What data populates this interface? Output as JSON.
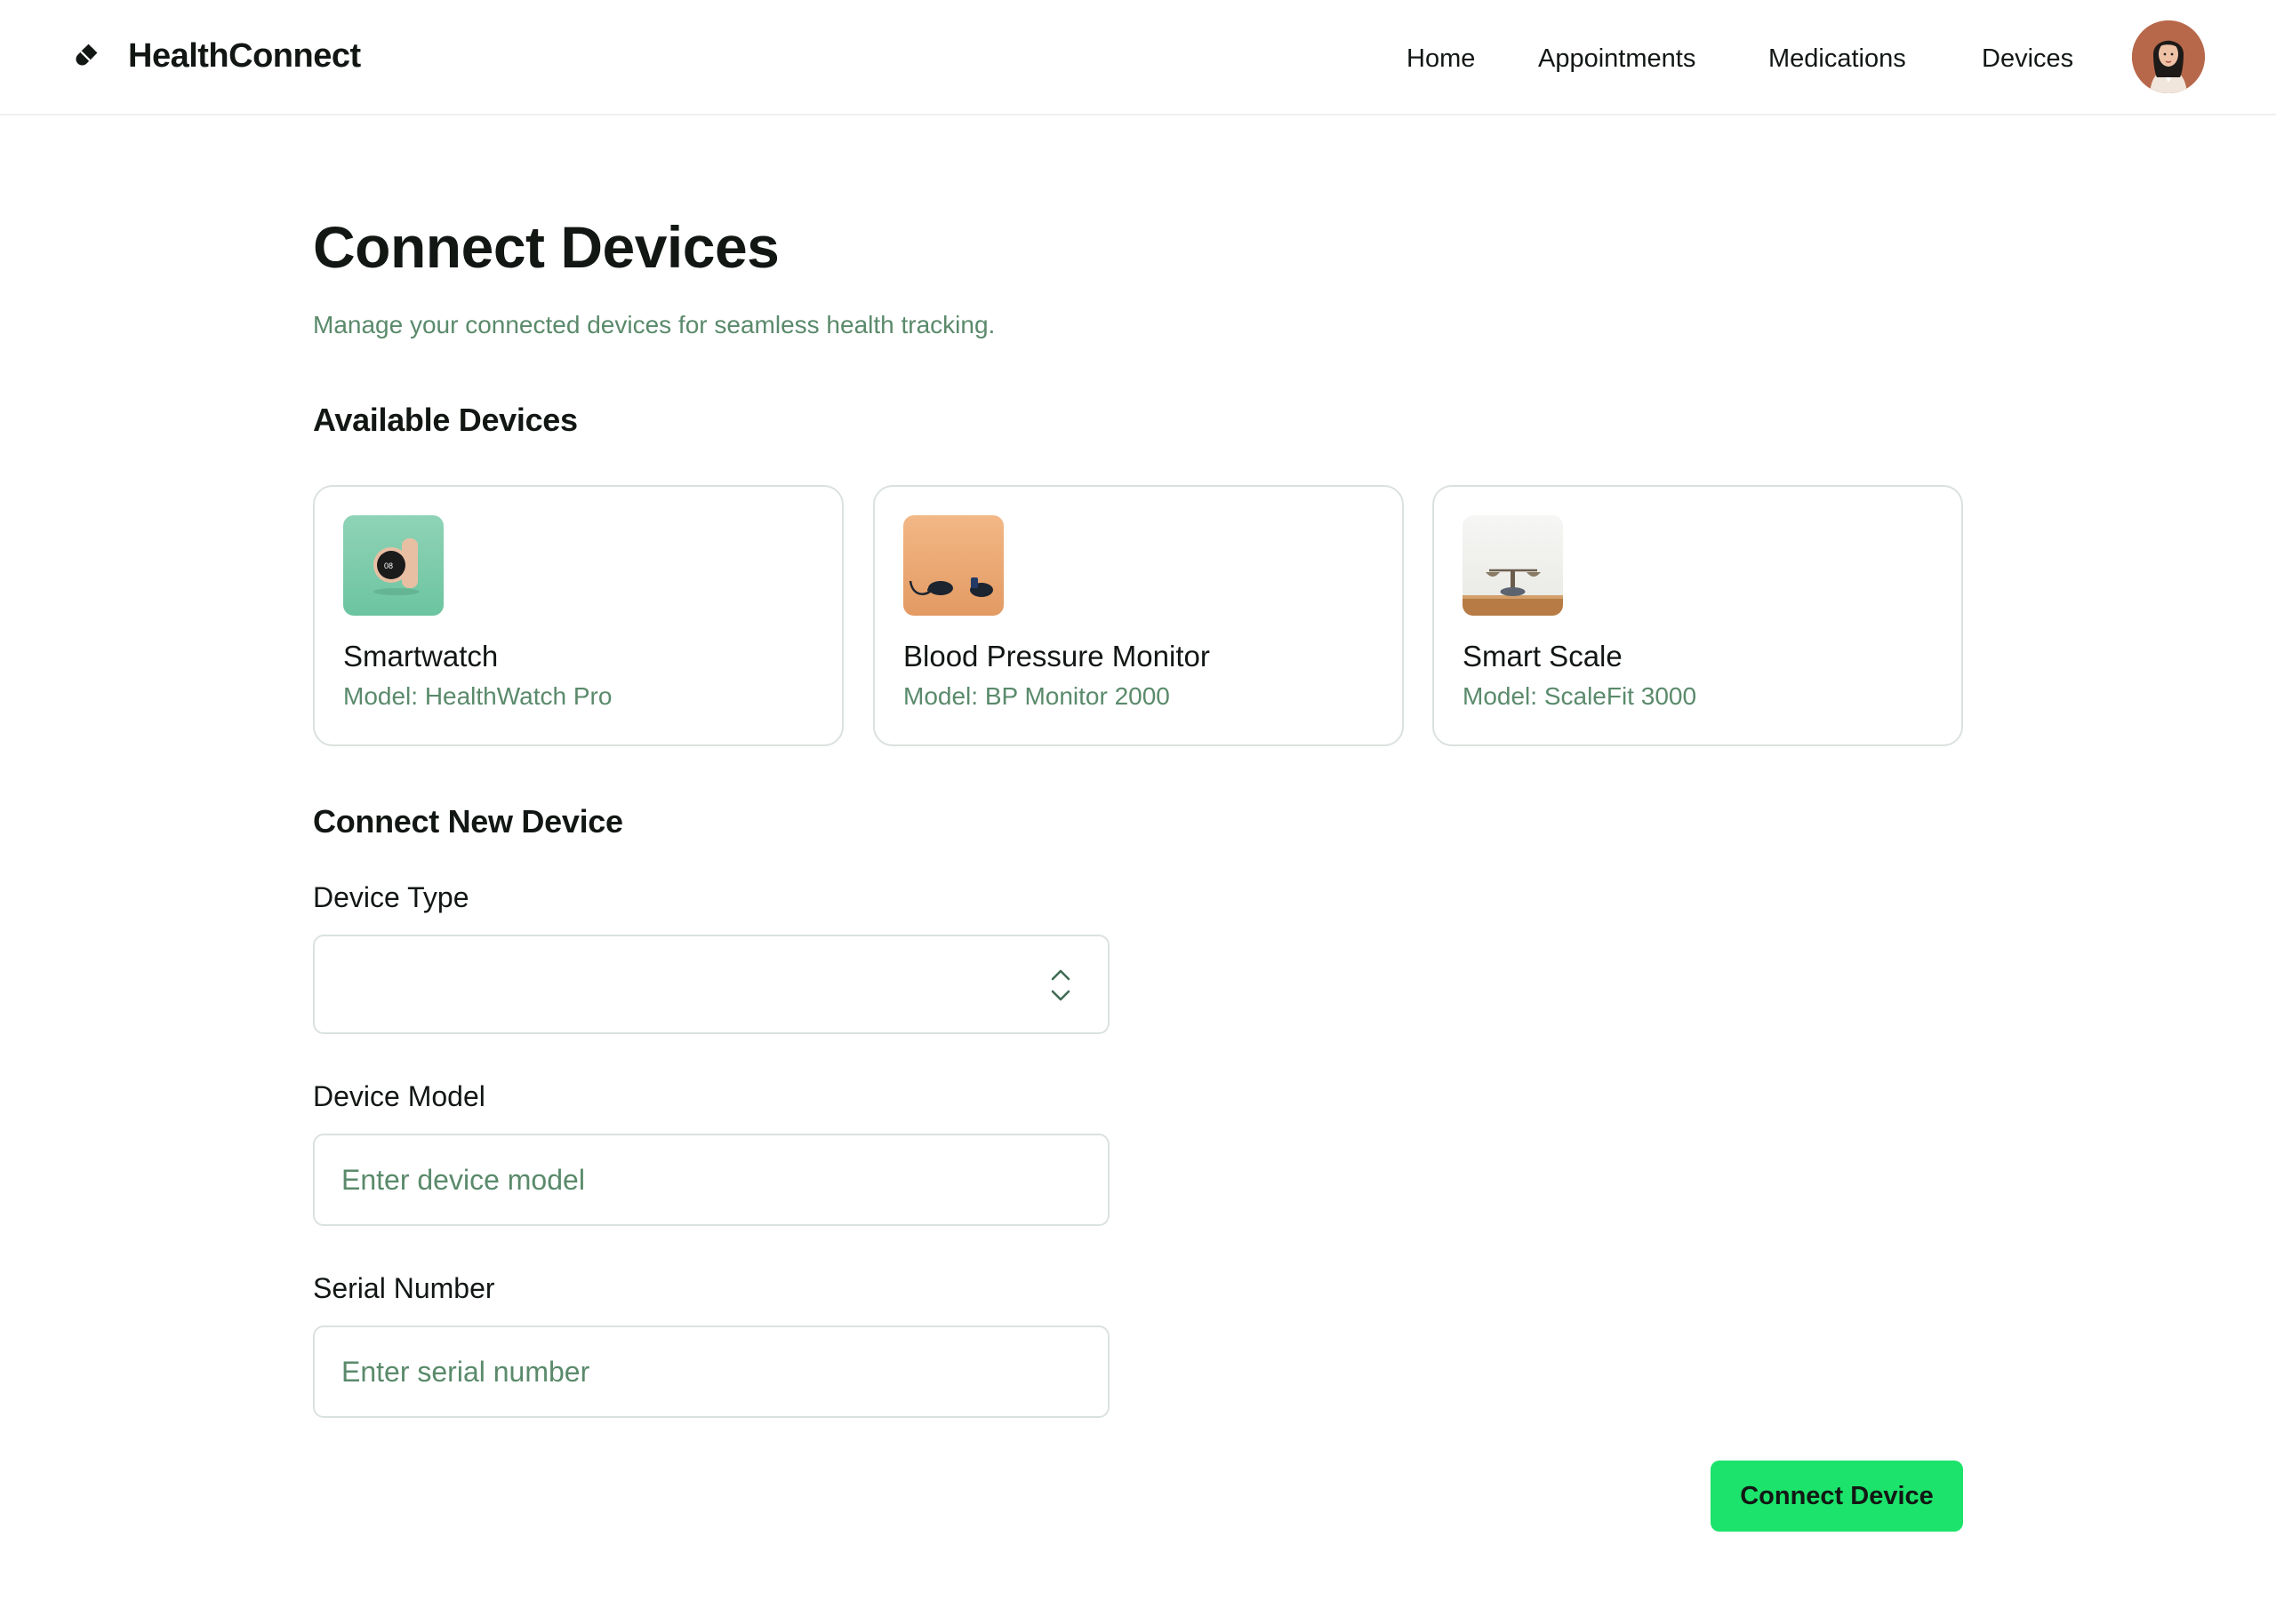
{
  "header": {
    "brand_name": "HealthConnect",
    "nav": [
      {
        "label": "Home"
      },
      {
        "label": "Appointments"
      },
      {
        "label": "Medications"
      },
      {
        "label": "Devices"
      }
    ]
  },
  "page": {
    "title": "Connect Devices",
    "subtitle": "Manage your connected devices for seamless health tracking."
  },
  "available": {
    "title": "Available Devices",
    "devices": [
      {
        "name": "Smartwatch",
        "model": "Model: HealthWatch Pro",
        "icon": "smartwatch-image"
      },
      {
        "name": "Blood Pressure Monitor",
        "model": "Model: BP Monitor 2000",
        "icon": "blood-pressure-monitor-image"
      },
      {
        "name": "Smart Scale",
        "model": "Model: ScaleFit 3000",
        "icon": "smart-scale-image"
      }
    ]
  },
  "connect_form": {
    "title": "Connect New Device",
    "device_type": {
      "label": "Device Type",
      "value": ""
    },
    "device_model": {
      "label": "Device Model",
      "placeholder": "Enter device model"
    },
    "serial_number": {
      "label": "Serial Number",
      "placeholder": "Enter serial number"
    },
    "submit_label": "Connect Device"
  },
  "colors": {
    "accent": "#1ce36b",
    "muted_text": "#5a8a6b",
    "border": "#dbe2dd",
    "text": "#121714"
  }
}
